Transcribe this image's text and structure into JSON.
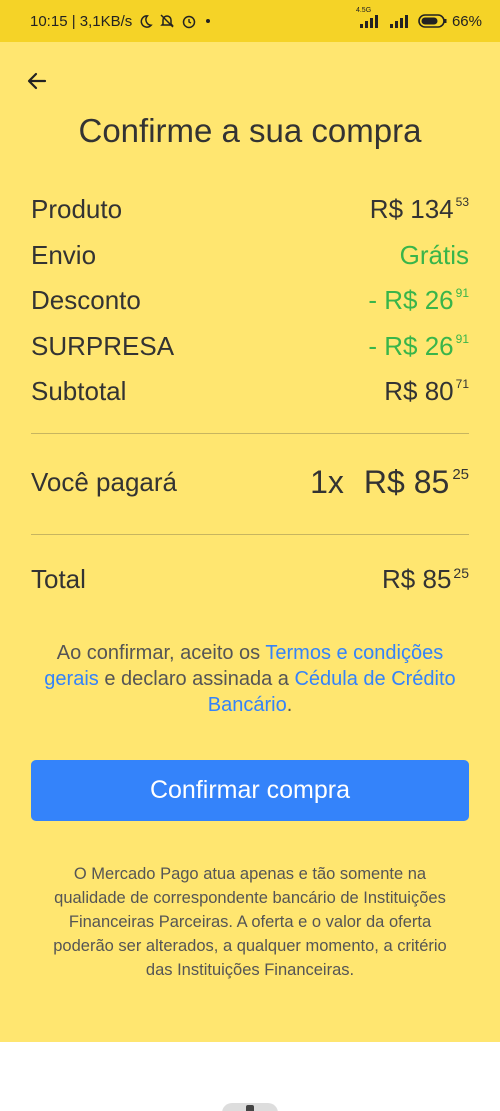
{
  "status_bar": {
    "time_speed": "10:15 | 3,1KB/s",
    "network_tag": "4.5G",
    "battery_percent": "66%"
  },
  "header": {
    "title": "Confirme a sua compra"
  },
  "summary": {
    "rows": [
      {
        "label": "Produto",
        "amount": "R$ 134",
        "cents": "53"
      },
      {
        "label": "Envio",
        "amount": "Grátis",
        "cents": ""
      },
      {
        "label": "Desconto",
        "amount": "- R$ 26",
        "cents": "91"
      },
      {
        "label": "SURPRESA",
        "amount": "- R$ 26",
        "cents": "91"
      },
      {
        "label": "Subtotal",
        "amount": "R$ 80",
        "cents": "71"
      }
    ]
  },
  "payment": {
    "label": "Você pagará",
    "installments": "1x",
    "amount": "R$ 85",
    "cents": "25"
  },
  "total": {
    "label": "Total",
    "amount": "R$ 85",
    "cents": "25"
  },
  "terms": {
    "prefix": "Ao confirmar, aceito os ",
    "link1": "Termos e condições gerais",
    "middle": " e declaro assinada a ",
    "link2": "Cédula de Crédito Bancário",
    "suffix": "."
  },
  "confirm_button": "Confirmar compra",
  "disclaimer": "O Mercado Pago atua apenas e tão somente na qualidade de correspondente bancário de Instituições Financeiras Parceiras. A oferta e o valor da oferta poderão ser alterados, a qualquer momento, a critério das Instituições Financeiras.",
  "colors": {
    "background": "#ffe670",
    "status_bar": "#f5d327",
    "accent_blue": "#3483fa",
    "discount_green": "#39b54a"
  }
}
